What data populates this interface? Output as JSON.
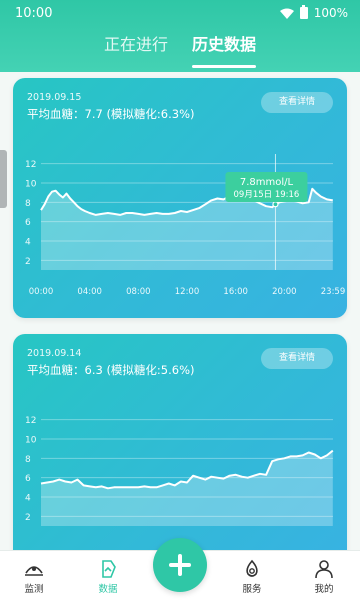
{
  "status_bar": {
    "time": "10:00",
    "battery": "100%"
  },
  "tabs": [
    {
      "label": "正在进行",
      "active": false
    },
    {
      "label": "历史数据",
      "active": true
    }
  ],
  "cards": [
    {
      "date": "2019.09.15",
      "summary": "平均血糖：7.7 (模拟糖化:6.3%)",
      "detail_button": "查看详情",
      "tooltip": {
        "value": "7.8mmol/L",
        "time": "09月15日 19:16"
      }
    },
    {
      "date": "2019.09.14",
      "summary": "平均血糖：6.3 (模拟糖化:5.6%)",
      "detail_button": "查看详情"
    }
  ],
  "nav": [
    {
      "label": "监测",
      "icon": "monitor-icon"
    },
    {
      "label": "数据",
      "icon": "data-icon",
      "active": true
    },
    {
      "label": "",
      "icon": "add-icon"
    },
    {
      "label": "服务",
      "icon": "service-icon"
    },
    {
      "label": "我的",
      "icon": "profile-icon"
    }
  ],
  "colors": {
    "accent": "#2fc7a6",
    "card_from": "#27c6c3",
    "card_to": "#38b2e2"
  },
  "chart_data": [
    {
      "type": "area",
      "x_ticks": [
        "00:00",
        "04:00",
        "08:00",
        "12:00",
        "16:00",
        "20:00",
        "23:59"
      ],
      "y_ticks": [
        2,
        4,
        6,
        8,
        10,
        12
      ],
      "ylim": [
        1,
        13
      ],
      "grid": true,
      "series": [
        {
          "x": [
            0,
            0.3,
            0.6,
            0.9,
            1.2,
            1.5,
            1.8,
            2.1,
            2.4,
            2.7,
            3.0,
            3.3,
            3.6,
            4.0,
            4.5,
            5,
            5.5,
            6,
            6.5,
            7,
            7.5,
            8,
            8.5,
            9,
            9.5,
            10,
            10.5,
            11,
            11.5,
            12,
            12.5,
            13,
            13.5,
            14,
            14.5,
            15,
            15.5,
            16,
            16.5,
            17,
            17.5,
            18,
            18.5,
            19,
            19.27,
            19.6,
            20,
            20.5,
            21,
            21.5,
            22,
            22.3,
            22.6,
            23,
            23.5,
            23.98
          ],
          "y": [
            7.2,
            7.8,
            8.6,
            9.1,
            9.2,
            8.8,
            8.5,
            8.9,
            8.4,
            8.0,
            7.6,
            7.3,
            7.1,
            6.9,
            6.7,
            6.8,
            6.9,
            6.8,
            6.7,
            6.9,
            6.9,
            6.8,
            6.7,
            6.8,
            6.9,
            6.8,
            6.8,
            6.9,
            7.1,
            7.0,
            7.2,
            7.4,
            7.8,
            8.2,
            8.4,
            8.3,
            8.6,
            8.7,
            8.6,
            8.4,
            8.2,
            7.9,
            7.6,
            7.5,
            7.8,
            8.0,
            8.1,
            8.2,
            8.1,
            7.9,
            8.0,
            9.4,
            9.0,
            8.6,
            8.3,
            8.2
          ]
        }
      ]
    },
    {
      "type": "area",
      "y_ticks": [
        2,
        4,
        6,
        8,
        10,
        12
      ],
      "ylim": [
        1,
        13
      ],
      "grid": true,
      "series": [
        {
          "x": [
            0,
            0.5,
            1,
            1.5,
            2,
            2.5,
            3,
            3.5,
            4,
            4.5,
            5,
            5.5,
            6,
            6.5,
            7,
            7.5,
            8,
            8.5,
            9,
            9.5,
            10,
            10.5,
            11,
            11.5,
            12,
            12.5,
            13,
            13.5,
            14,
            14.5,
            15,
            15.5,
            16,
            16.5,
            17,
            17.5,
            18,
            18.5,
            19,
            19.5,
            20,
            20.5,
            21,
            21.5,
            22,
            22.5,
            23,
            23.5,
            23.98
          ],
          "y": [
            5.4,
            5.5,
            5.6,
            5.8,
            5.6,
            5.5,
            5.8,
            5.2,
            5.1,
            5.0,
            5.1,
            4.9,
            5.0,
            5.0,
            5.0,
            5.0,
            5.0,
            5.1,
            5.0,
            5.0,
            5.2,
            5.4,
            5.2,
            5.6,
            5.5,
            6.2,
            6.0,
            5.8,
            6.1,
            6.0,
            5.9,
            6.2,
            6.3,
            6.1,
            6.0,
            6.2,
            6.4,
            6.3,
            7.7,
            7.9,
            8.0,
            8.2,
            8.2,
            8.3,
            8.6,
            8.4,
            8.0,
            8.3,
            8.8
          ]
        }
      ]
    }
  ]
}
